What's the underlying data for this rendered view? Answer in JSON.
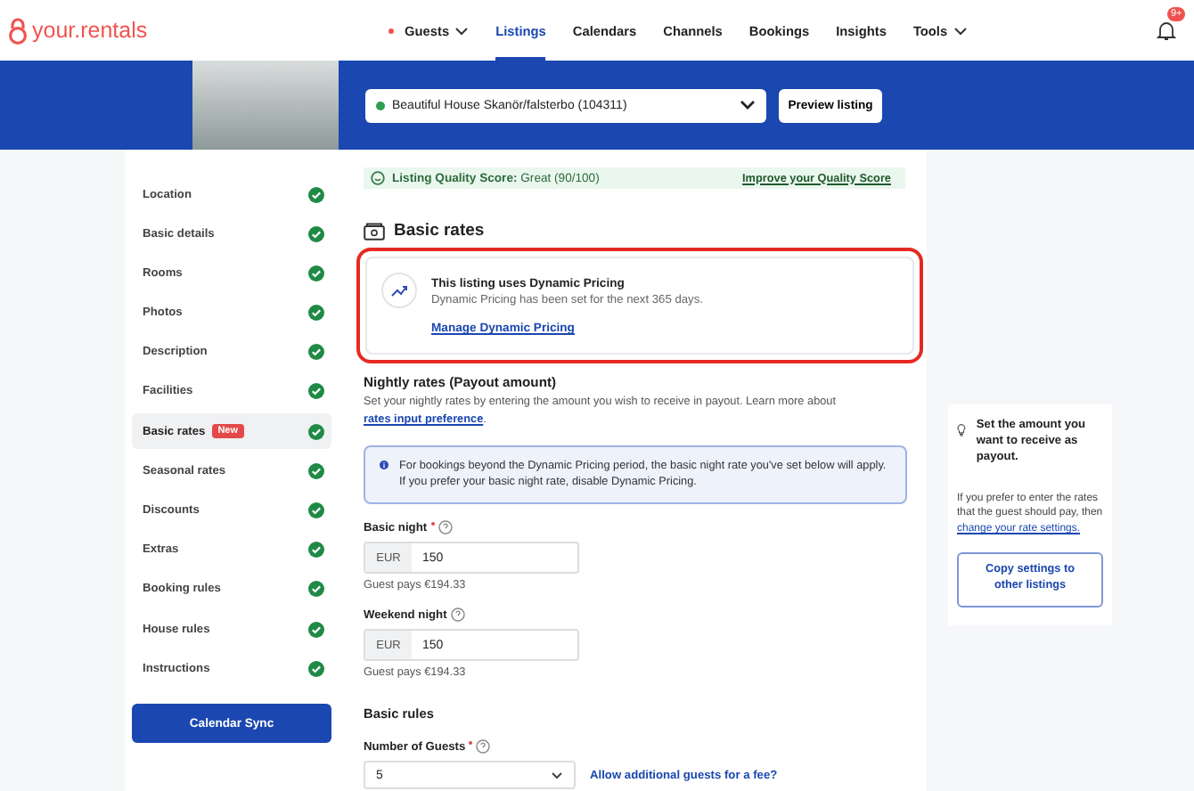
{
  "logo": {
    "text": "your.rentals"
  },
  "nav": [
    {
      "label": "Guests",
      "selected": false,
      "dot": true,
      "dropdown": true
    },
    {
      "label": "Listings",
      "selected": true,
      "dot": false,
      "dropdown": false
    },
    {
      "label": "Calendars",
      "selected": false,
      "dot": false,
      "dropdown": false
    },
    {
      "label": "Channels",
      "selected": false,
      "dot": false,
      "dropdown": false
    },
    {
      "label": "Bookings",
      "selected": false,
      "dot": false,
      "dropdown": false
    },
    {
      "label": "Insights",
      "selected": false,
      "dot": false,
      "dropdown": false
    },
    {
      "label": "Tools",
      "selected": false,
      "dot": false,
      "dropdown": true
    }
  ],
  "notifications": {
    "badge": "9+"
  },
  "banner": {
    "listing_select": {
      "value": "Beautiful House Skanör/falsterbo (104311)",
      "color": "#2e9e4f"
    },
    "preview_button": "Preview listing"
  },
  "sidebar": {
    "items": [
      {
        "label": "Location",
        "selected": false,
        "complete": true
      },
      {
        "label": "Basic details",
        "selected": false,
        "complete": true
      },
      {
        "label": "Rooms",
        "selected": false,
        "complete": true
      },
      {
        "label": "Photos",
        "selected": false,
        "complete": true
      },
      {
        "label": "Description",
        "selected": false,
        "complete": true
      },
      {
        "label": "Facilities",
        "selected": false,
        "complete": true
      },
      {
        "label": "Basic rates",
        "selected": true,
        "complete": true,
        "badge": "New"
      },
      {
        "label": "Seasonal rates",
        "selected": false,
        "complete": true
      },
      {
        "label": "Discounts",
        "selected": false,
        "complete": true
      },
      {
        "label": "Extras",
        "selected": false,
        "complete": true
      },
      {
        "label": "Booking rules",
        "selected": false,
        "complete": true
      },
      {
        "label": "House rules",
        "selected": false,
        "complete": true
      },
      {
        "label": "Instructions",
        "selected": false,
        "complete": true
      }
    ],
    "button": "Calendar Sync"
  },
  "quality": {
    "text": "**Listing Quality Score:** Great (90/100)",
    "link": "Improve your Quality Score"
  },
  "title": "Basic rates",
  "dynamic_pricing": {
    "highlighted": true,
    "title": "This listing uses Dynamic Pricing",
    "text": "Dynamic Pricing has been set for the next 365 days.",
    "link": "Manage Dynamic Pricing"
  },
  "nightly": {
    "title": "Nightly rates (Payout amount)",
    "text": "Set your nightly rates by entering the amount you wish to receive in payout. Learn more about",
    "link": "rates input preference",
    "after_link": "."
  },
  "info": "For bookings beyond the Dynamic Pricing period, the basic night rate you've set below will apply. If you prefer your basic night rate, disable Dynamic Pricing.",
  "fields": [
    {
      "label": "Basic night",
      "required": true,
      "currency": "EUR",
      "value": "150",
      "note": "Guest pays €194.33"
    },
    {
      "label": "Weekend night",
      "required": false,
      "currency": "EUR",
      "value": "150",
      "note": "Guest pays €194.33"
    }
  ],
  "rules": {
    "title": "Basic rules",
    "guests": {
      "label": "Number of Guests",
      "required": true,
      "value": "5",
      "link": "Allow additional guests for a fee?"
    }
  },
  "tip": {
    "title": "Set the amount you want to receive as payout.",
    "text": "If you prefer to enter the rates that the guest should pay, then",
    "link": "change your rate settings.",
    "button": "Copy settings to other listings"
  }
}
